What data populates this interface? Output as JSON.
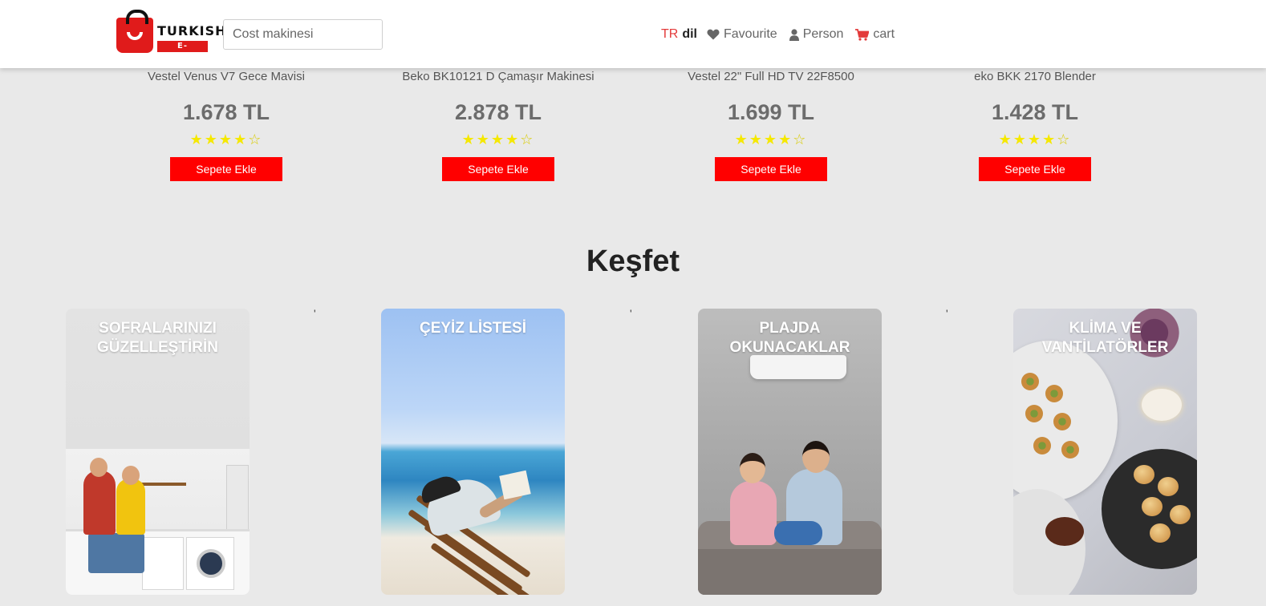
{
  "header": {
    "logo": {
      "line1": "TURKISH",
      "line2": "E-MARKET"
    },
    "search": {
      "placeholder": "Cost makinesi"
    },
    "nav": {
      "lang_code": "TR",
      "lang_label": "dil",
      "favourite": "Favourite",
      "person": "Person",
      "cart": "cart"
    }
  },
  "products": [
    {
      "name": "Vestel Venus V7 Gece Mavisi",
      "price": "1.678 TL",
      "rating": 4,
      "button": "Sepete Ekle"
    },
    {
      "name": "Beko BK10121 D Çamaşır Makinesi",
      "price": "2.878 TL",
      "rating": 4,
      "button": "Sepete Ekle"
    },
    {
      "name": "Vestel 22\" Full HD TV 22F8500",
      "price": "1.699 TL",
      "rating": 4,
      "button": "Sepete Ekle"
    },
    {
      "name": "eko BKK 2170 Blender",
      "price": "1.428 TL",
      "rating": 4,
      "button": "Sepete Ekle"
    }
  ],
  "kesfet": {
    "title": "Keşfet",
    "separator": "'",
    "cards": [
      {
        "title": "SOFRALARINIZI GÜZELLEŞTİRİN"
      },
      {
        "title": "ÇEYİZ LİSTESİ"
      },
      {
        "title": "PLAJDA OKUNACAKLAR"
      },
      {
        "title": "KLİMA VE VANTİLATÖRLER"
      }
    ]
  },
  "colors": {
    "accent": "#ff0000",
    "background": "#e9e9e9",
    "star": "#f5e800",
    "lang_code": "#e33a3a"
  }
}
